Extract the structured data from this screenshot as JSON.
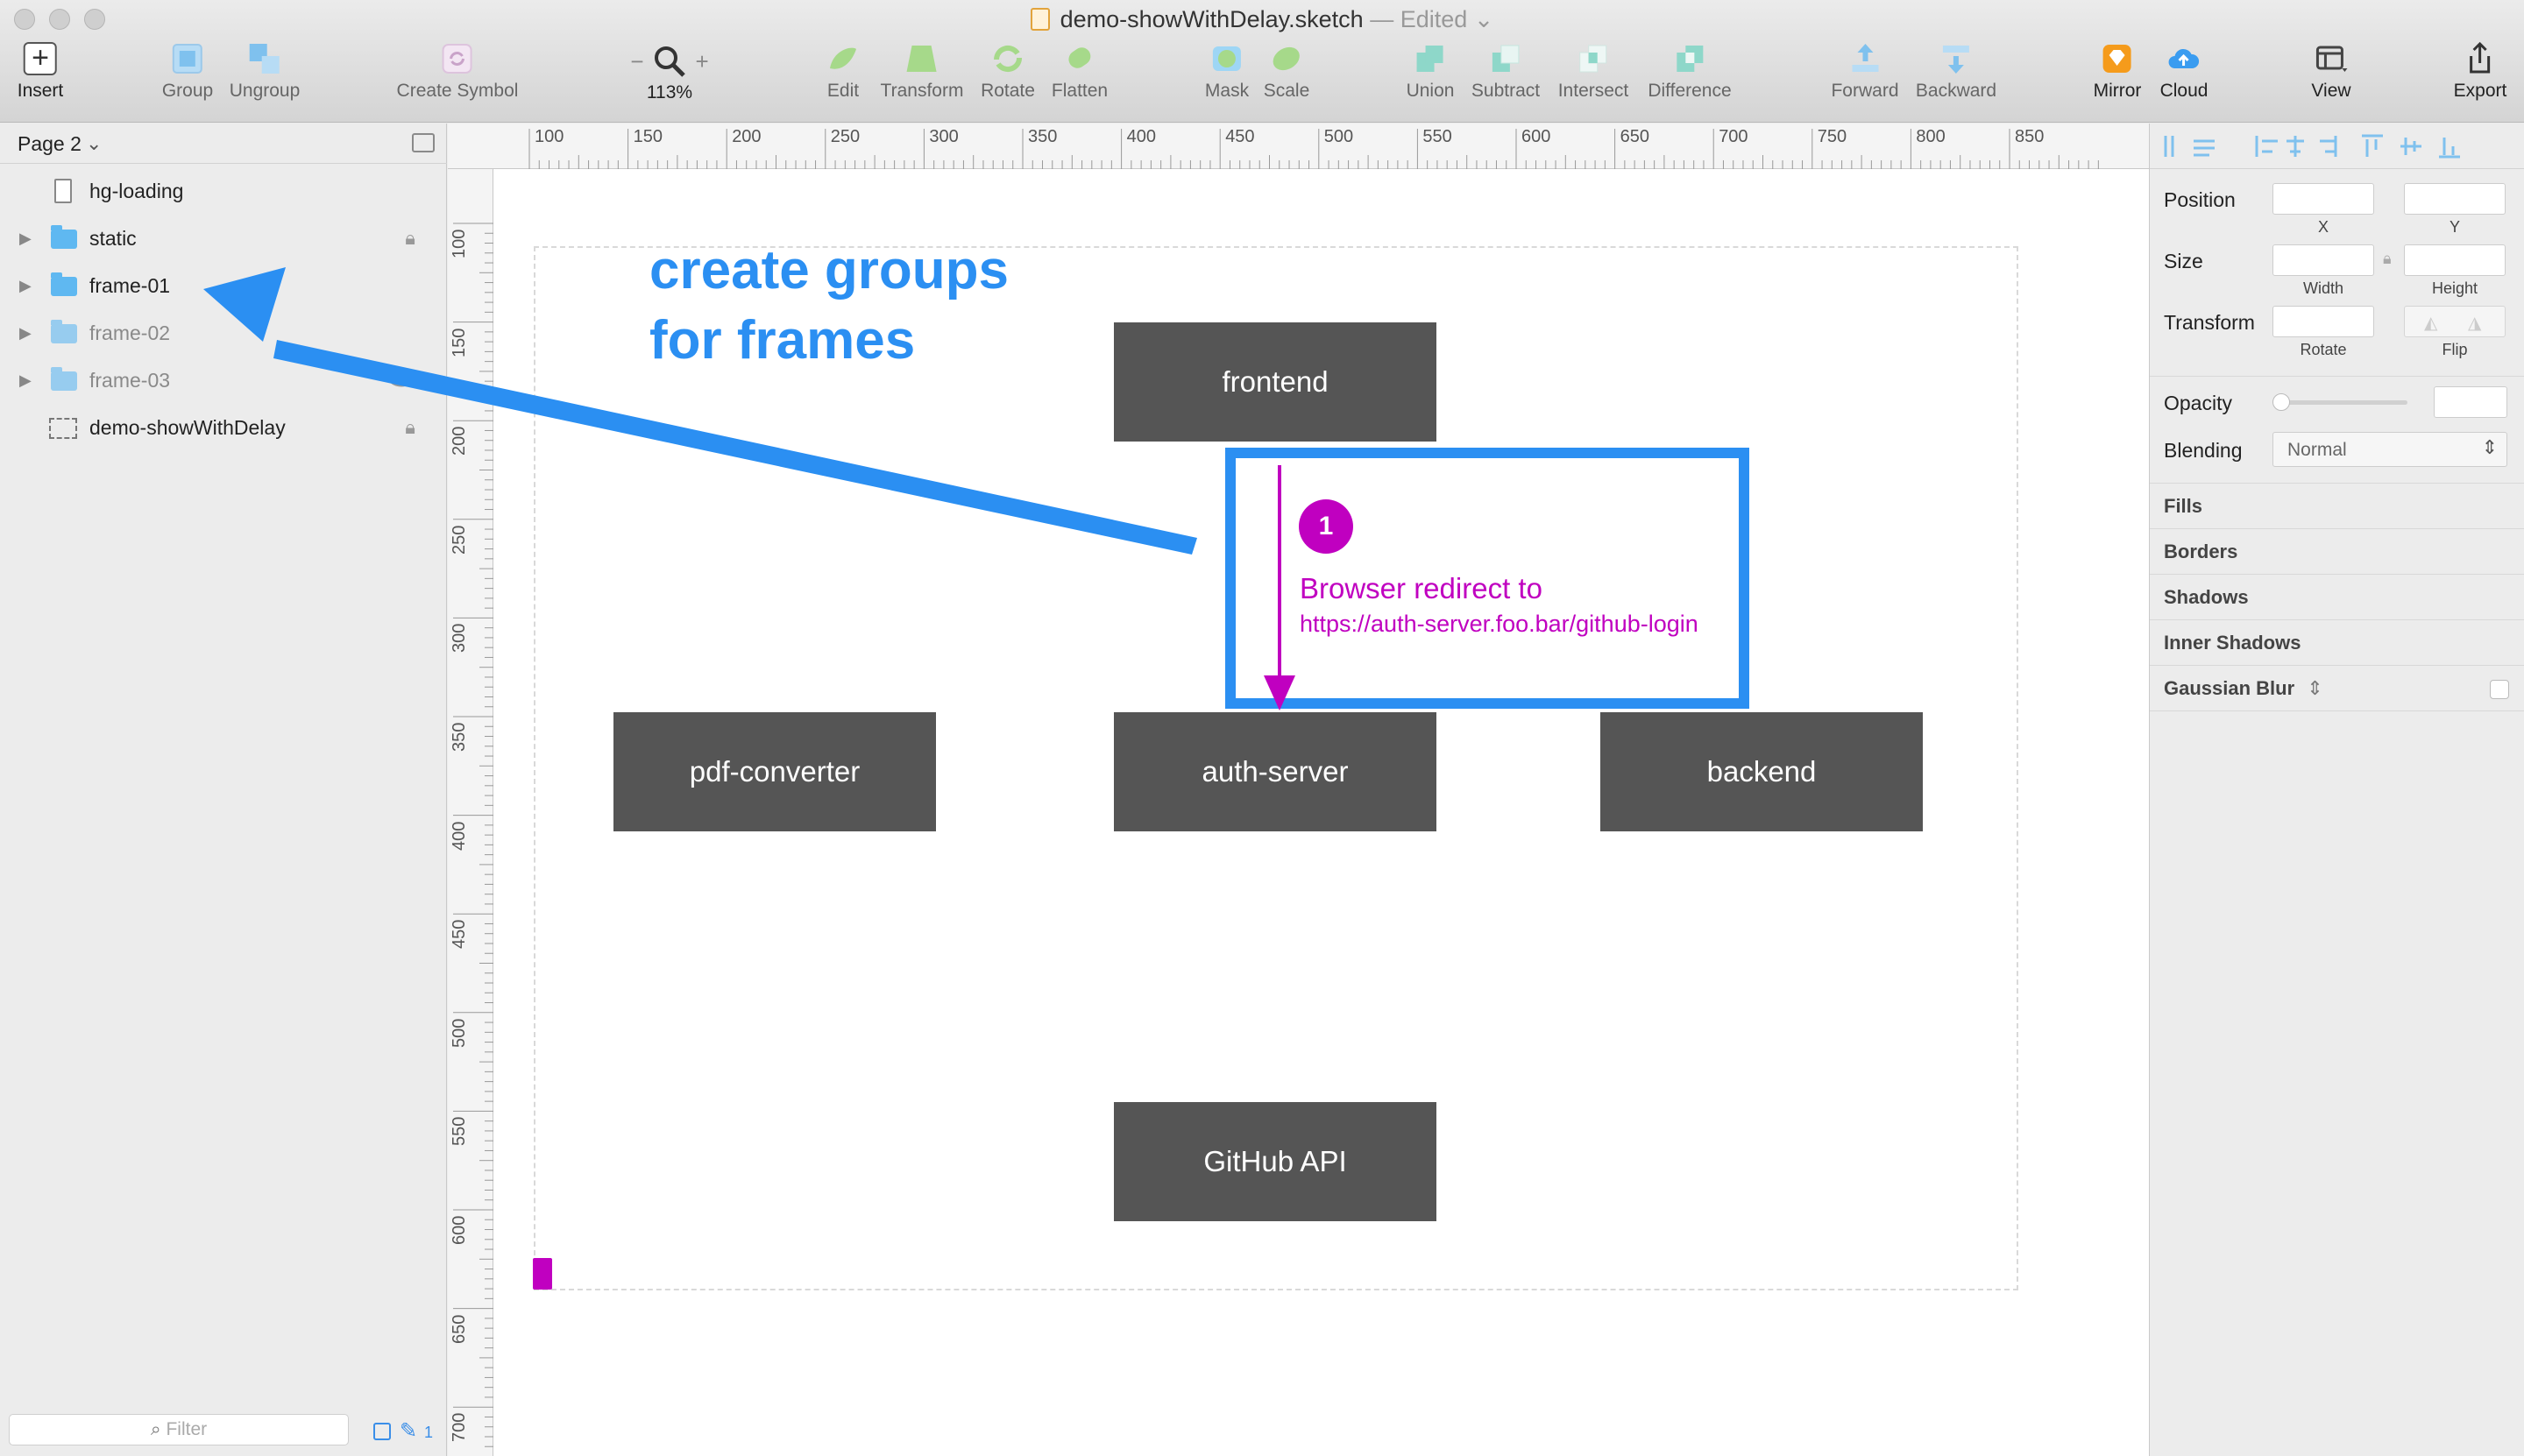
{
  "window": {
    "title": "demo-showWithDelay.sketch",
    "edited": "— Edited"
  },
  "toolbar": {
    "insert": "Insert",
    "group": "Group",
    "ungroup": "Ungroup",
    "create_symbol": "Create Symbol",
    "zoom": "113%",
    "edit": "Edit",
    "transform": "Transform",
    "rotate": "Rotate",
    "flatten": "Flatten",
    "mask": "Mask",
    "scale": "Scale",
    "union": "Union",
    "subtract": "Subtract",
    "intersect": "Intersect",
    "difference": "Difference",
    "forward": "Forward",
    "backward": "Backward",
    "mirror": "Mirror",
    "cloud": "Cloud",
    "view": "View",
    "export": "Export"
  },
  "sidebar": {
    "page": "Page 2",
    "layers": [
      {
        "name": "hg-loading",
        "type": "artboard"
      },
      {
        "name": "static",
        "type": "folder",
        "lock": true
      },
      {
        "name": "frame-01",
        "type": "folder"
      },
      {
        "name": "frame-02",
        "type": "folder",
        "dim": true
      },
      {
        "name": "frame-03",
        "type": "folder",
        "dim": true,
        "hidden": true
      },
      {
        "name": "demo-showWithDelay",
        "type": "slice",
        "lock": true
      }
    ],
    "filter_placeholder": "Filter",
    "bottom_count": "1"
  },
  "rulers": {
    "h_ticks": [
      "100",
      "150",
      "200",
      "250",
      "300",
      "350",
      "400",
      "450",
      "500",
      "550",
      "600",
      "650",
      "700",
      "750",
      "800",
      "850"
    ],
    "v_ticks": [
      "100",
      "150",
      "200",
      "250",
      "300",
      "350",
      "400",
      "450",
      "500",
      "550",
      "600",
      "650",
      "700"
    ]
  },
  "canvas": {
    "annotation_line1": "create groups",
    "annotation_line2": "for frames",
    "nodes": {
      "frontend": "frontend",
      "pdf_converter": "pdf-converter",
      "auth_server": "auth-server",
      "backend": "backend",
      "github_api": "GitHub API"
    },
    "step_number": "1",
    "step_title": "Browser redirect to",
    "step_url": "https://auth-server.foo.bar/github-login",
    "colors": {
      "accent_blue": "#2b8ff2",
      "magenta": "#c000c0",
      "node_gray": "#555555"
    }
  },
  "inspector": {
    "position": "Position",
    "x": "X",
    "y": "Y",
    "size": "Size",
    "width": "Width",
    "height": "Height",
    "transform": "Transform",
    "rotate": "Rotate",
    "flip": "Flip",
    "opacity": "Opacity",
    "blending": "Blending",
    "blending_value": "Normal",
    "fills": "Fills",
    "borders": "Borders",
    "shadows": "Shadows",
    "inner_shadows": "Inner Shadows",
    "gaussian_blur": "Gaussian Blur"
  }
}
